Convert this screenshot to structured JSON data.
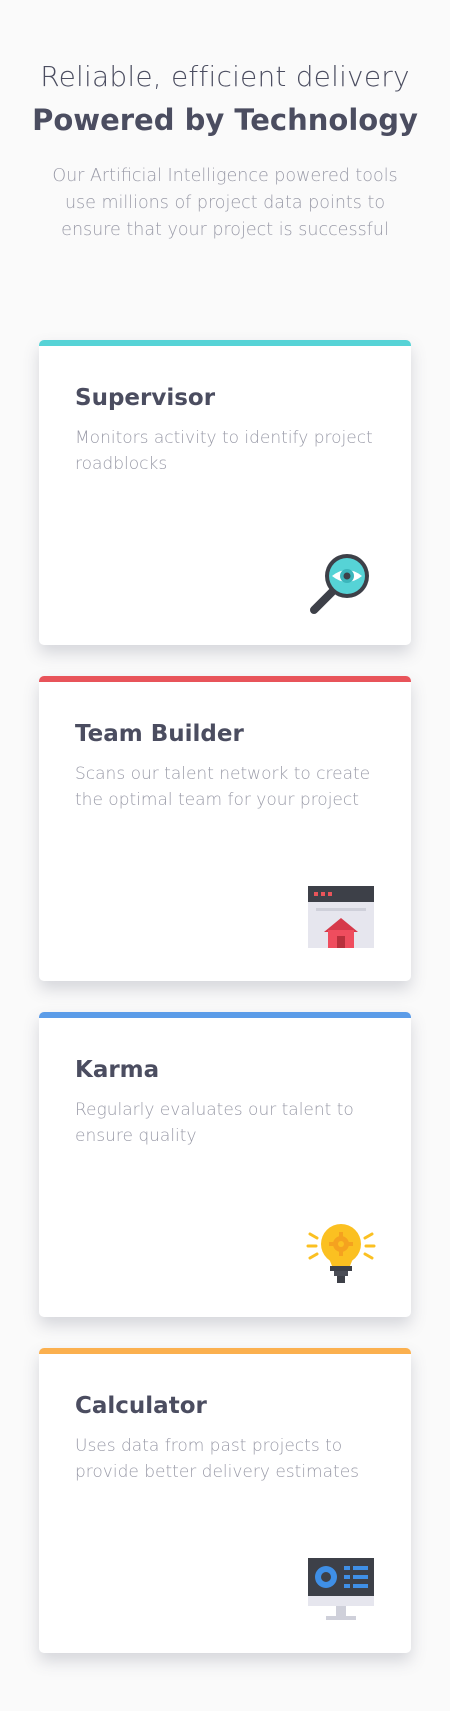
{
  "header": {
    "title_line1": "Reliable, efficient delivery",
    "title_line2": "Powered by Technology",
    "subtitle": "Our Artificial Intelligence powered tools use millions of project data points to ensure that your project is successful"
  },
  "cards": [
    {
      "title": "Supervisor",
      "description": "Monitors activity to identify project roadblocks",
      "accent": "#56d3d6",
      "icon": "magnifier-eye-icon"
    },
    {
      "title": "Team Builder",
      "description": "Scans our talent network to create the optimal team for your project",
      "accent": "#e8545a",
      "icon": "browser-home-icon"
    },
    {
      "title": "Karma",
      "description": "Regularly evaluates our talent to ensure quality",
      "accent": "#5b9ce8",
      "icon": "lightbulb-gear-icon"
    },
    {
      "title": "Calculator",
      "description": "Uses data from past projects to provide better delivery estimates",
      "accent": "#fbb04f",
      "icon": "monitor-chart-icon"
    }
  ]
}
